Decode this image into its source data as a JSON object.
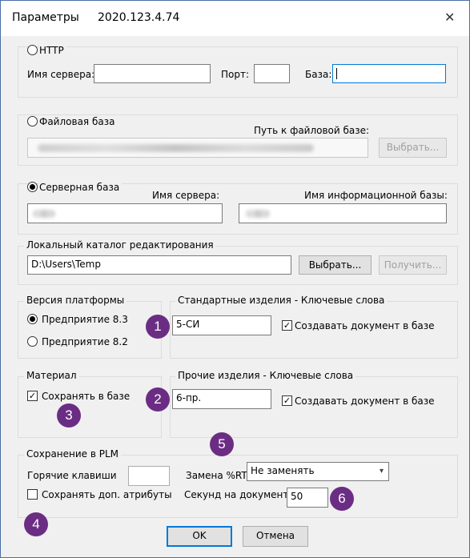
{
  "window": {
    "title": "Параметры",
    "version": "2020.123.4.74",
    "close_label": "✕"
  },
  "http": {
    "label": "HTTP",
    "server_label": "Имя сервера:",
    "server_value": "",
    "port_label": "Порт:",
    "port_value": "",
    "base_label": "База:",
    "base_value": ""
  },
  "file_base": {
    "label": "Файловая база",
    "path_label": "Путь к файловой базе:",
    "choose_label": "Выбрать..."
  },
  "server_base": {
    "label": "Серверная база",
    "server_label": "Имя сервера:",
    "ib_label": "Имя информационной базы:"
  },
  "local_catalog": {
    "legend": "Локальный каталог редактирования",
    "path_value": "D:\\Users\\Temp",
    "choose_label": "Выбрать...",
    "get_label": "Получить..."
  },
  "platform": {
    "legend": "Версия платформы",
    "options": [
      "Предприятие 8.3",
      "Предприятие 8.2"
    ],
    "selected": "Предприятие 8.3"
  },
  "standard": {
    "legend": "Стандартные изделия - Ключевые слова",
    "keyword_value": "5-СИ",
    "create_doc_label": "Создавать документ в базе",
    "create_doc_checked": true
  },
  "material": {
    "legend": "Материал",
    "save_label": "Сохранять в базе",
    "save_checked": true
  },
  "other": {
    "legend": "Прочие изделия - Ключевые слова",
    "keyword_value": "6-пр.",
    "create_doc_label": "Создавать документ в базе",
    "create_doc_checked": true
  },
  "plm": {
    "legend": "Сохранение в PLM",
    "hotkeys_label": "Горячие клавиши",
    "hotkeys_value": "",
    "replace_label": "Замена %RT",
    "replace_value": "Не заменять",
    "save_attrs_label": "Сохранять доп. атрибуты",
    "save_attrs_checked": false,
    "seconds_label": "Секунд на документ",
    "seconds_value": "50"
  },
  "footer": {
    "ok_label": "OK",
    "cancel_label": "Отмена"
  },
  "badges": [
    "1",
    "2",
    "3",
    "4",
    "5",
    "6"
  ],
  "colors": {
    "badge": "#6b2d84",
    "accent": "#0078d7",
    "frame": "#4a6fa5"
  }
}
